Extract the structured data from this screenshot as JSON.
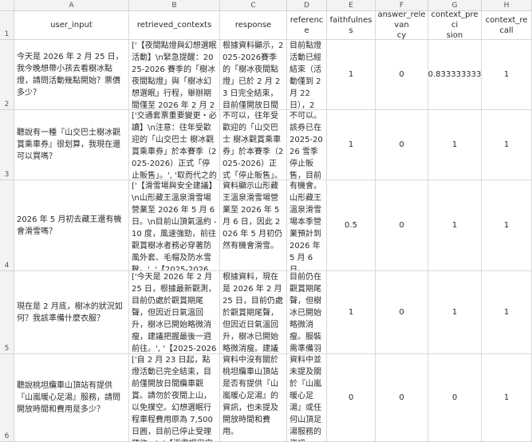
{
  "columns": [
    "A",
    "B",
    "C",
    "D",
    "E",
    "F",
    "G",
    "H"
  ],
  "rows": [
    "1",
    "2",
    "3",
    "4",
    "5",
    "6"
  ],
  "headers": {
    "user_input": "user_input",
    "retrieved_contexts": "retrieved_contexts",
    "response": "response",
    "reference": "reference",
    "faithfulness": "faithfulness",
    "answer_relevancy": "answer_relevan\ncy",
    "context_precision": "context_preci\nsion",
    "context_recall": "context_recall"
  },
  "data": [
    {
      "user_input": "今天是 2026 年 2 月 25 日，我今晚想帶小孩去看樹冰點燈，請問活動幾點開始？票價多少？",
      "retrieved_contexts": "['【夜間點燈與幻想選眠活動】\\n緊急提醒：2025-2026 賽季的「樹冰夜間點燈」與「樹冰幻想選眠」行程，舉辦期間僅至 2026 年 2 月 22",
      "response": "根據資料顯示，2025-2026賽季的「樹冰夜間點燈」已於 2 月 23 日完全結束，目前僅開放日間觀賞遊客。幻想選",
      "reference": "目前點燈活動已經結束（活動僅到 2 月 22 日），2 月 23 日是日間",
      "faithfulness": "1",
      "answer_relevancy": "0",
      "context_precision": "0.833333333",
      "context_recall": "1"
    },
    {
      "user_input": "聽說有一種『山交巴士樹冰觀賞乘車券』很划算，我現在還可以買嗎？",
      "retrieved_contexts": "['交通套票重要變更・必讀】\\n注意：往年受歡迎的「山交巴士 樹冰觀賞乘車券」於本賽季（2025-2026）正式「停止販售」。', '取而代之的是全新的「巴士＋空中纜",
      "response": "不可以，往年受歡迎的「山交巴士 樹冰觀賞乘車券」於本賽季（2025-2026）正式「停止販售」。取而代之的是全新的",
      "reference": "不可以。該券已在 2025-2026 雪季停止販售，目前改為販售「巴士＋",
      "faithfulness": "1",
      "answer_relevancy": "0",
      "context_precision": "1",
      "context_recall": "1"
    },
    {
      "user_input": "2026 年 5 月初去藏王還有機會滑雪嗎？",
      "retrieved_contexts": "['【滑雪場與安全建議】\\n山形藏王溫泉滑雪場營業至 2026 年 5 月 6 日。\\n目前山頂氣溫約 -10 度，風速強勁，前往觀賞樹冰者務必穿著防風外套、毛帽及防水雪靴。', '【2025-2026 藏王樹冰觀賞期間與",
      "response": "資料顯示山形藏王溫泉滑雪場營業至 2026 年 5 月 6 日，因此 2026 年 5 月初仍然有機會滑雪。",
      "reference": "有機會。山形藏王溫泉滑雪場本季營業預計到 2026 年 5 月 6 日。",
      "faithfulness": "0.5",
      "answer_relevancy": "0",
      "context_precision": "1",
      "context_recall": "1"
    },
    {
      "user_input": "現在是 2 月底，樹冰的狀況如何？我該準備什麼衣服？",
      "retrieved_contexts": "['今天是 2026 年 2 月 25 日，根據最新觀測，目前仍處於觀賞期尾聲，但因近日氣溫回升，樹冰已開始略微消瘦，建議把握最後一週前往。', '【2025-2026 藏王樹冰觀賞期間與",
      "response": "根據資料，現在是 2026 年 2 月 25 日，目前仍處於觀賞期尾聲，但因近日氣溫回升，樹冰已開始略微消瘦。建議把握最後一週前",
      "reference": "目前仍在觀賞期尾聲，但樹冰已開始略微消瘦。服裝需準備羽絨衣、防",
      "faithfulness": "1",
      "answer_relevancy": "0",
      "context_precision": "1",
      "context_recall": "1"
    },
    {
      "user_input": "聽說桃坦纜車山頂站有提供『山嵐暖心足湯』服務，請問開放時間和費用是多少？",
      "retrieved_contexts": "['自 2 月 23 日起，點燈活動已完全結束，目前僅開放日間纜車觀賞。請勿於夜間上山，以免撲空。幻想選眠行程車程費用原為 7,500 日圓，目前已停止受理預約。', '【滑雪場與安全建議】",
      "response": "資料中沒有關於桃坦纜車山頂站是否有提供『山嵐暖心足湯』的資訊，也未提及開放時間和費用。",
      "reference": "資料中並未提及關於『山嵐暖心足湯』或任何山頂足湯服務的資訊。",
      "faithfulness": "0",
      "answer_relevancy": "0",
      "context_precision": "0",
      "context_recall": "1"
    }
  ]
}
